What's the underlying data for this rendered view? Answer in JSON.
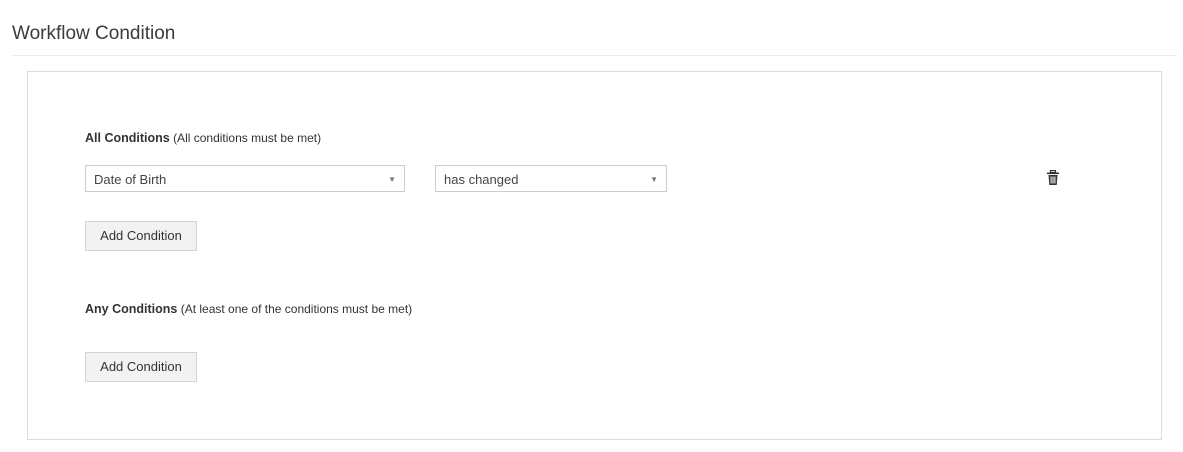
{
  "page": {
    "title": "Workflow Condition"
  },
  "all_conditions": {
    "heading": "All Conditions",
    "note": "(All conditions must be met)",
    "rows": [
      {
        "field": "Date of Birth",
        "operator": "has changed"
      }
    ],
    "add_label": "Add Condition"
  },
  "any_conditions": {
    "heading": "Any Conditions",
    "note": "(At least one of the conditions must be met)",
    "add_label": "Add Condition"
  },
  "icons": {
    "dropdown": "chevron-down-icon",
    "delete": "trash-icon"
  },
  "colors": {
    "button_bg": "#f2f2f2",
    "border": "#cccccc",
    "text": "#333333"
  }
}
